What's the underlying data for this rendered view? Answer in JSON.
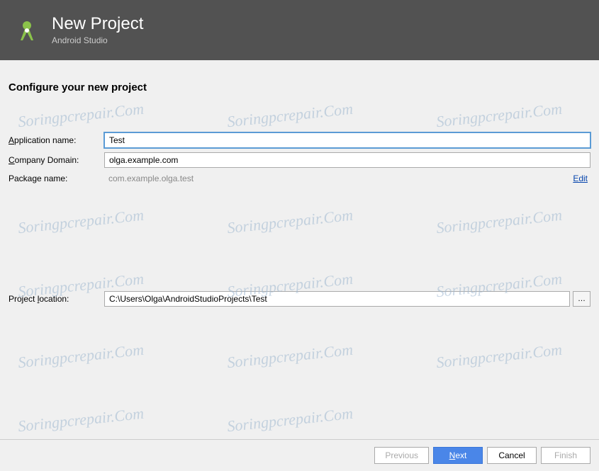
{
  "header": {
    "title": "New Project",
    "subtitle": "Android Studio"
  },
  "section_title": "Configure your new project",
  "fields": {
    "app_name": {
      "label_pre": "A",
      "label_mid": "pplication name:",
      "value": "Test"
    },
    "company_domain": {
      "label_pre": "C",
      "label_mid": "ompany Domain:",
      "value": "olga.example.com"
    },
    "package_name": {
      "label": "Package name:",
      "value": "com.example.olga.test",
      "edit_label": "Edit"
    },
    "project_location": {
      "label_pre": "Project ",
      "label_underline": "l",
      "label_post": "ocation:",
      "value": "C:\\Users\\Olga\\AndroidStudioProjects\\Test",
      "browse_label": "…"
    }
  },
  "buttons": {
    "previous": "Previous",
    "next_pre": "N",
    "next_post": "ext",
    "cancel": "Cancel",
    "finish": "Finish"
  },
  "watermark_text": "Soringpcrepair.Com"
}
